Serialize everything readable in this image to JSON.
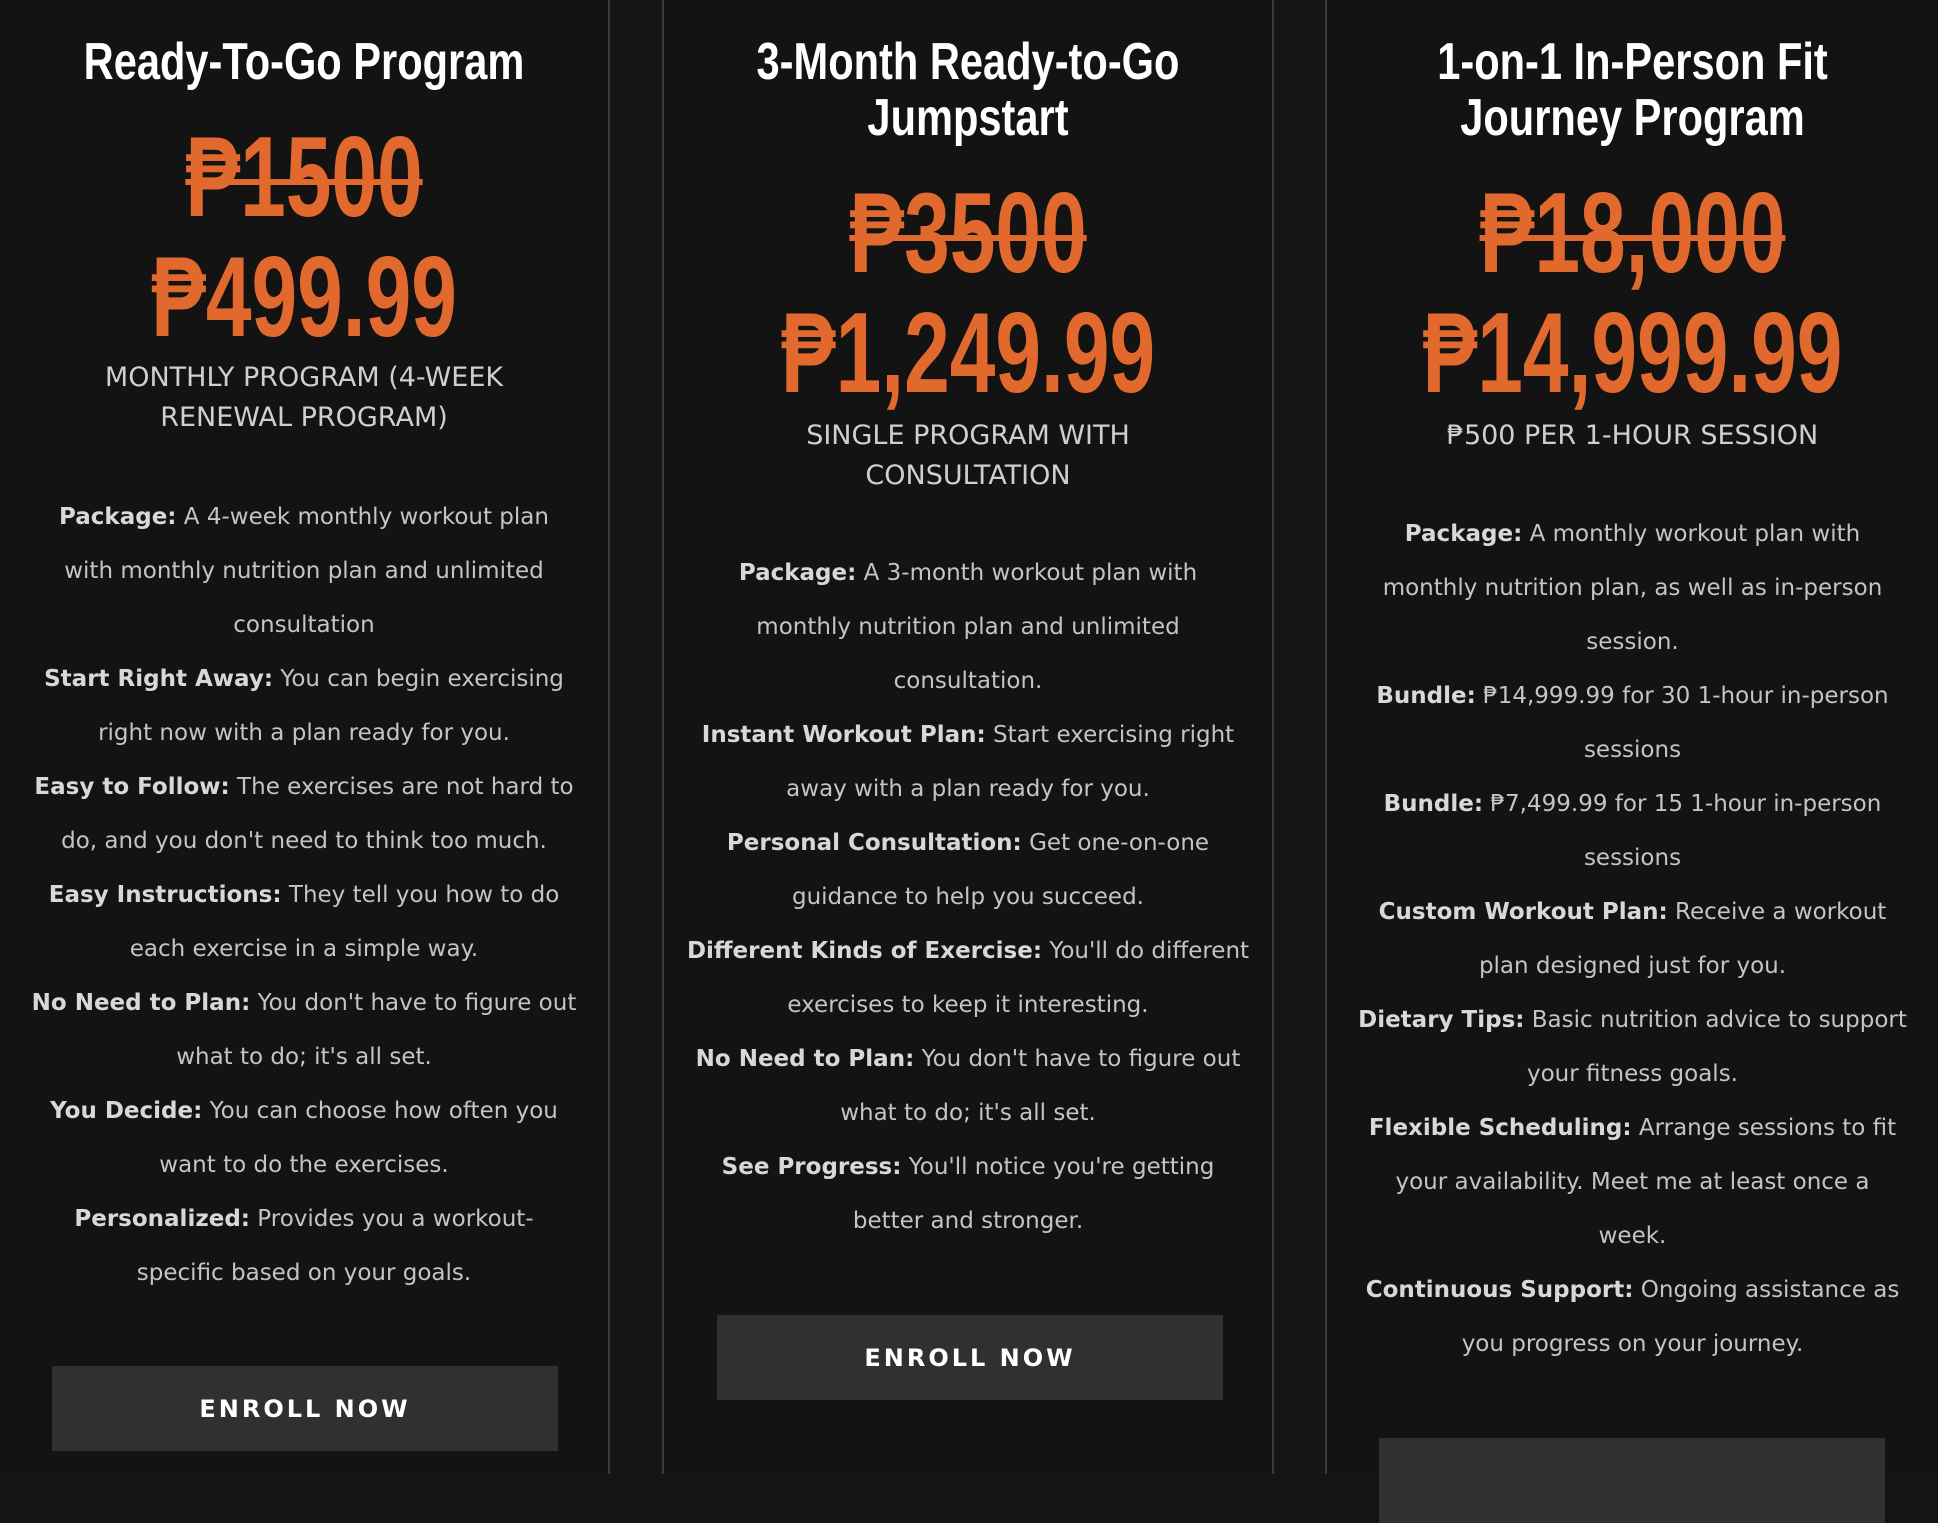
{
  "plans": [
    {
      "title": [
        "Ready-To-Go Program"
      ],
      "old_price": "₱1500",
      "new_price": "₱499.99",
      "subtitle": [
        "MONTHLY PROGRAM (4-WEEK",
        "RENEWAL PROGRAM)"
      ],
      "features": [
        {
          "lines": [
            {
              "label": "Package:",
              "text": " A 4-week monthly workout plan"
            },
            {
              "text": "with monthly nutrition plan and unlimited"
            },
            {
              "text": "consultation"
            }
          ]
        },
        {
          "lines": [
            {
              "label": "Start Right Away:",
              "text": " You can begin exercising"
            },
            {
              "text": "right now with a plan ready for you."
            }
          ]
        },
        {
          "lines": [
            {
              "label": "Easy to Follow:",
              "text": " The exercises are not hard to"
            },
            {
              "text": "do, and you don't need to think too much."
            }
          ]
        },
        {
          "lines": [
            {
              "label": "Easy Instructions:",
              "text": " They tell you how to do"
            },
            {
              "text": "each exercise in a simple way."
            }
          ]
        },
        {
          "lines": [
            {
              "label": "No Need to Plan:",
              "text": " You don't have to figure out"
            },
            {
              "text": "what to do; it's all set."
            }
          ]
        },
        {
          "lines": [
            {
              "label": "You Decide:",
              "text": " You can choose how often you"
            },
            {
              "text": "want to do the exercises."
            }
          ]
        },
        {
          "lines": [
            {
              "label": "Personalized:",
              "text": " Provides you a workout-"
            },
            {
              "text": "specific based on your goals."
            }
          ]
        }
      ],
      "button": "ENROLL NOW"
    },
    {
      "title": [
        "3-Month Ready-to-Go",
        "Jumpstart"
      ],
      "old_price": "₱3500",
      "new_price": "₱1,249.99",
      "subtitle": [
        "SINGLE PROGRAM WITH",
        "CONSULTATION"
      ],
      "features": [
        {
          "lines": [
            {
              "label": "Package:",
              "text": " A 3-month workout plan with"
            },
            {
              "text": "monthly nutrition plan and unlimited"
            },
            {
              "text": "consultation."
            }
          ]
        },
        {
          "lines": [
            {
              "label": "Instant Workout Plan:",
              "text": " Start exercising right"
            },
            {
              "text": "away with a plan ready for you."
            }
          ]
        },
        {
          "lines": [
            {
              "label": "Personal Consultation:",
              "text": " Get one-on-one"
            },
            {
              "text": "guidance to help you succeed."
            }
          ]
        },
        {
          "lines": [
            {
              "label": "Different Kinds of Exercise:",
              "text": " You'll do different"
            },
            {
              "text": "exercises to keep it interesting."
            }
          ]
        },
        {
          "lines": [
            {
              "label": "No Need to Plan:",
              "text": " You don't have to figure out"
            },
            {
              "text": "what to do; it's all set."
            }
          ]
        },
        {
          "lines": [
            {
              "label": "See Progress:",
              "text": " You'll notice you're getting"
            },
            {
              "text": "better and stronger."
            }
          ]
        }
      ],
      "button": "ENROLL NOW"
    },
    {
      "title": [
        "1-on-1 In-Person Fit",
        "Journey Program"
      ],
      "old_price": "₱18,000",
      "new_price": "₱14,999.99",
      "subtitle": [
        "₱500 PER 1-HOUR SESSION"
      ],
      "features": [
        {
          "lines": [
            {
              "label": "Package:",
              "text": " A monthly workout plan with"
            },
            {
              "text": "monthly nutrition plan, as well as in-person"
            },
            {
              "text": "session."
            }
          ]
        },
        {
          "lines": [
            {
              "label": "Bundle:",
              "text": " ₱14,999.99 for 30 1-hour in-person"
            },
            {
              "text": "sessions"
            }
          ]
        },
        {
          "lines": [
            {
              "label": "Bundle:",
              "text": " ₱7,499.99 for 15 1-hour in-person"
            },
            {
              "text": "sessions"
            }
          ]
        },
        {
          "lines": [
            {
              "label": "Custom Workout Plan:",
              "text": " Receive a workout"
            },
            {
              "text": "plan designed just for you."
            }
          ]
        },
        {
          "lines": [
            {
              "label": "Dietary Tips:",
              "text": " Basic nutrition advice to support"
            },
            {
              "text": "your fitness goals."
            }
          ]
        },
        {
          "lines": [
            {
              "label": "Flexible Scheduling:",
              "text": " Arrange sessions to fit"
            },
            {
              "text": "your availability. Meet me at least once a"
            },
            {
              "text": "week."
            }
          ]
        },
        {
          "lines": [
            {
              "label": "Continuous Support:",
              "text": " Ongoing assistance as"
            },
            {
              "text": "you progress on your journey."
            }
          ]
        }
      ],
      "button": ""
    }
  ],
  "colors": {
    "accent": "#e2692d",
    "background": "#131313",
    "button": "#303030"
  }
}
